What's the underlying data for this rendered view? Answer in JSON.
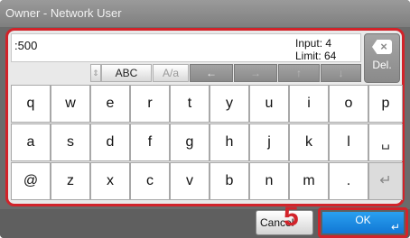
{
  "window": {
    "title": "Owner - Network User"
  },
  "input": {
    "value": ":500",
    "input_label": "Input: 4",
    "limit_label": "Limit: 64"
  },
  "toolbar": {
    "mode_label": "ABC",
    "case_label": "A/a",
    "left_arrow": "←",
    "right_arrow": "→",
    "up_arrow": "↑",
    "down_arrow": "↓"
  },
  "delete": {
    "icon": "×",
    "label": "Del."
  },
  "keyboard": {
    "row1": [
      "q",
      "w",
      "e",
      "r",
      "t",
      "y",
      "u",
      "i",
      "o",
      "p"
    ],
    "row2": [
      "a",
      "s",
      "d",
      "f",
      "g",
      "h",
      "j",
      "k",
      "l"
    ],
    "row3": [
      "@",
      "z",
      "x",
      "c",
      "v",
      "b",
      "n",
      "m",
      "."
    ]
  },
  "space_icon": "␣",
  "enter_icon": "↵",
  "footer": {
    "cancel_label": "Cancel",
    "ok_label": "OK",
    "ok_enter_icon": "↵",
    "step_marker": "5"
  },
  "colors": {
    "highlight": "#d2232a",
    "ok_button": "#1a8ae6"
  }
}
